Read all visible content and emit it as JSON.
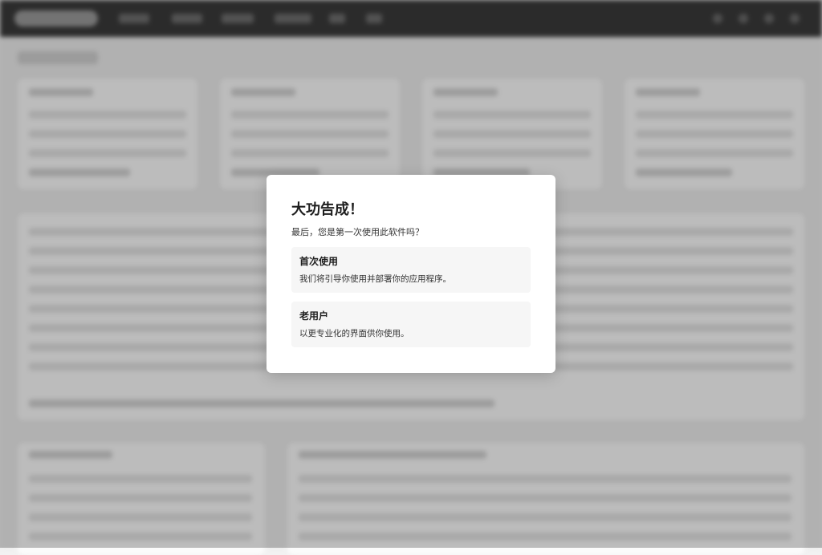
{
  "dialog": {
    "title": "大功告成！",
    "subtitle": "最后，您是第一次使用此软件吗？",
    "options": [
      {
        "title": "首次使用",
        "description": "我们将引导你使用并部署你的应用程序。"
      },
      {
        "title": "老用户",
        "description": "以更专业化的界面供你使用。"
      }
    ]
  },
  "colors": {
    "overlay": "#000000",
    "dialog_bg": "#ffffff",
    "option_bg": "#f6f6f6",
    "text_primary": "#1e1e1e"
  }
}
